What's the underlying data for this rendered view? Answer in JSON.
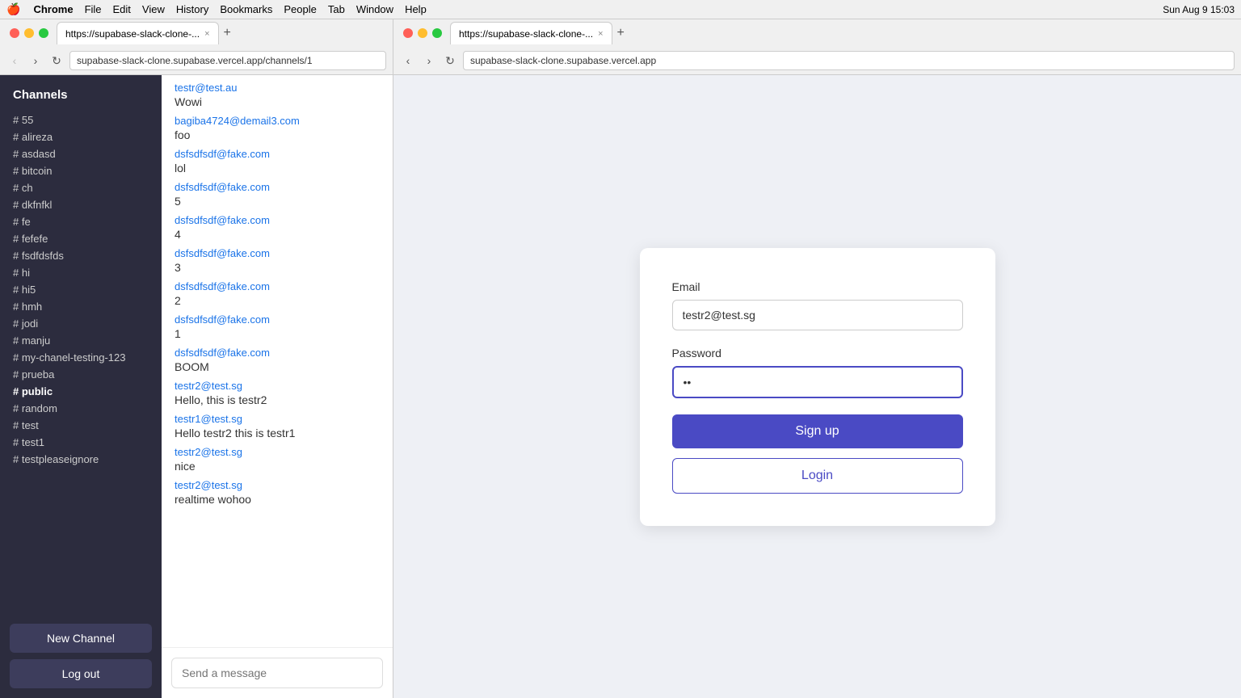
{
  "menubar": {
    "apple": "🍎",
    "app_name": "Chrome",
    "menu_items": [
      "File",
      "Edit",
      "View",
      "History",
      "Bookmarks",
      "People",
      "Tab",
      "Window",
      "Help"
    ],
    "right": "Sun Aug 9  15:03"
  },
  "left_browser": {
    "tab_label": "https://supabase-slack-clone-...",
    "address": "supabase-slack-clone.supabase.vercel.app/channels/1"
  },
  "right_browser": {
    "tab_label": "https://supabase-slack-clone-...",
    "address": "supabase-slack-clone.supabase.vercel.app"
  },
  "sidebar": {
    "header": "Channels",
    "channels": [
      {
        "name": "# 55"
      },
      {
        "name": "# alireza"
      },
      {
        "name": "# asdasd"
      },
      {
        "name": "# bitcoin"
      },
      {
        "name": "# ch"
      },
      {
        "name": "# dkfnfkl"
      },
      {
        "name": "# fe"
      },
      {
        "name": "# fefefe"
      },
      {
        "name": "# fsdfdsfds"
      },
      {
        "name": "# hi"
      },
      {
        "name": "# hi5"
      },
      {
        "name": "# hmh"
      },
      {
        "name": "# jodi"
      },
      {
        "name": "# manju"
      },
      {
        "name": "# my-chanel-testing-123"
      },
      {
        "name": "# prueba"
      },
      {
        "name": "# public",
        "bold": true
      },
      {
        "name": "# random"
      },
      {
        "name": "# test"
      },
      {
        "name": "# test1"
      },
      {
        "name": "# testpleaseignore"
      }
    ],
    "new_channel_label": "New Channel",
    "logout_label": "Log out"
  },
  "messages": [
    {
      "author": "testr@test.au",
      "text": "Wowi"
    },
    {
      "author": "bagiba4724@demail3.com",
      "text": "foo"
    },
    {
      "author": "dsfsdfsdf@fake.com",
      "text": "lol"
    },
    {
      "author": "dsfsdfsdf@fake.com",
      "text": "5"
    },
    {
      "author": "dsfsdfsdf@fake.com",
      "text": "4"
    },
    {
      "author": "dsfsdfsdf@fake.com",
      "text": "3"
    },
    {
      "author": "dsfsdfsdf@fake.com",
      "text": "2"
    },
    {
      "author": "dsfsdfsdf@fake.com",
      "text": "1"
    },
    {
      "author": "dsfsdfsdf@fake.com",
      "text": "BOOM"
    },
    {
      "author": "testr2@test.sg",
      "text": "Hello, this is testr2"
    },
    {
      "author": "testr1@test.sg",
      "text": "Hello testr2 this is testr1"
    },
    {
      "author": "testr2@test.sg",
      "text": "nice"
    },
    {
      "author": "testr2@test.sg",
      "text": "realtime wohoo"
    }
  ],
  "message_input_placeholder": "Send a message",
  "auth": {
    "email_label": "Email",
    "email_value": "testr2@test.sg",
    "password_label": "Password",
    "password_value": "••",
    "signup_label": "Sign up",
    "login_label": "Login"
  }
}
